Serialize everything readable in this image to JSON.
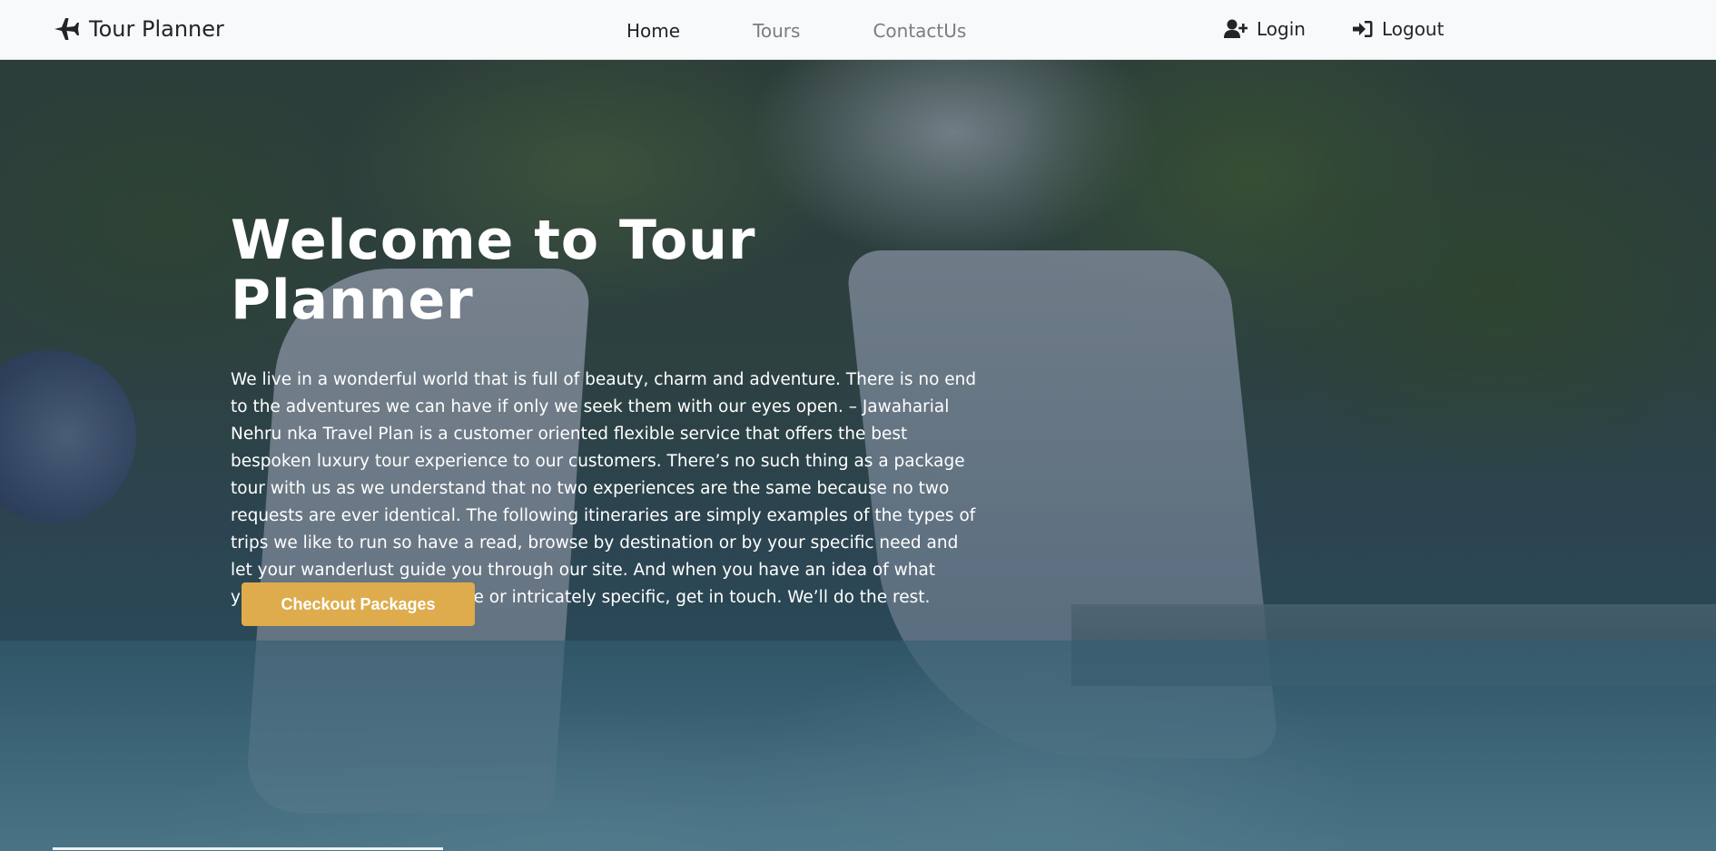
{
  "navbar": {
    "brand": "Tour Planner",
    "brand_icon": "plane-icon",
    "links": [
      {
        "label": "Home",
        "active": true
      },
      {
        "label": "Tours",
        "active": false
      },
      {
        "label": "ContactUs",
        "active": false
      }
    ],
    "login_label": "Login",
    "logout_label": "Logout"
  },
  "hero": {
    "title": "Welcome to Tour Planner",
    "text": "We live in a wonderful world that is full of beauty, charm and adventure. There is no end to the adventures we can have if only we seek them with our eyes open. – Jawaharial Nehru nka Travel Plan is a customer oriented flexible service that offers the best bespoken luxury tour experience to our customers. There’s no such thing as a package tour with us as we understand that no two experiences are the same because no two requests are ever identical. The following itineraries are simply examples of the types of trips we like to run so have a read, browse by destination or by your specific need and let your wanderlust guide you through our site. And when you have an idea of what you’re looking for, be it vague or intricately specific, get in touch. We’ll do the rest.",
    "cta_label": "Checkout Packages"
  },
  "colors": {
    "navbar_bg": "#f8f9fb",
    "button": "#deac4d",
    "text_dark": "#212529",
    "text_muted": "#7a7d82"
  }
}
